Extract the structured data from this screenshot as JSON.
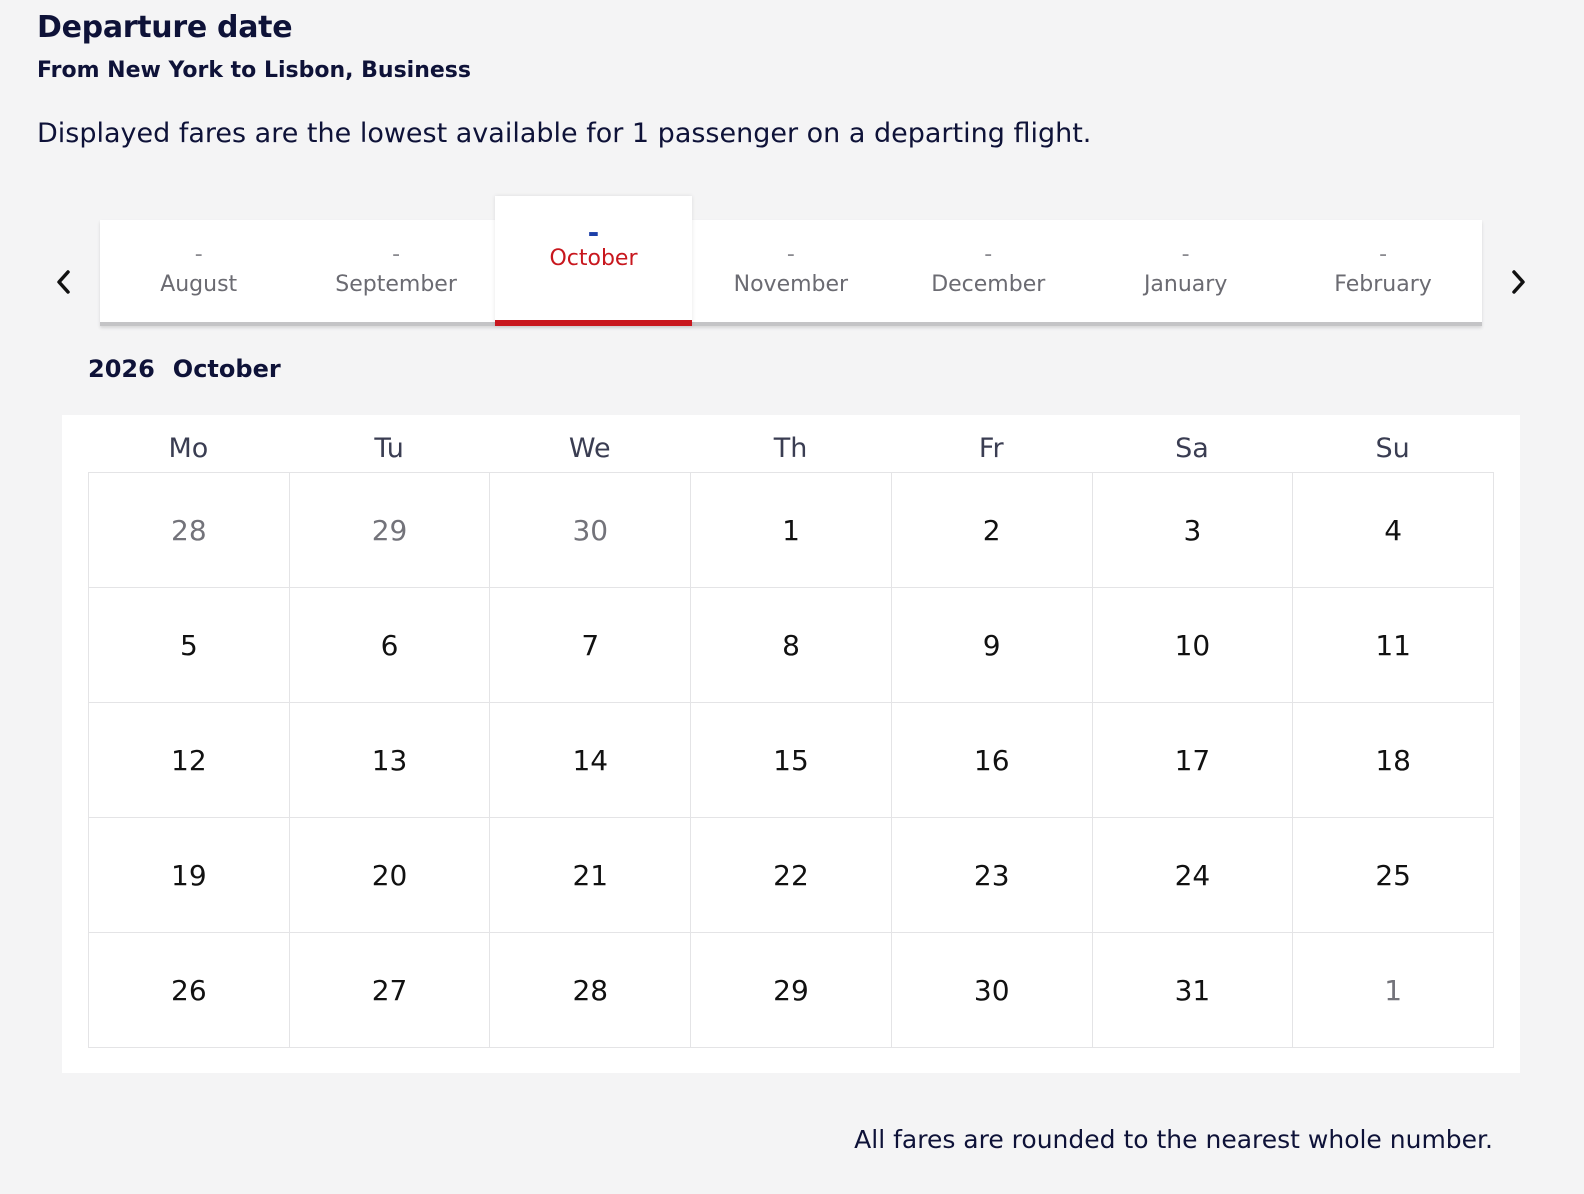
{
  "header": {
    "title": "Departure date",
    "subtitle": "From New York to Lisbon, Business",
    "info": "Displayed fares are the lowest available for 1 passenger on a departing flight."
  },
  "month_tabs": [
    {
      "fare": "-",
      "label": "August",
      "active": false
    },
    {
      "fare": "-",
      "label": "September",
      "active": false
    },
    {
      "fare": "-",
      "label": "October",
      "active": true
    },
    {
      "fare": "-",
      "label": "November",
      "active": false
    },
    {
      "fare": "-",
      "label": "December",
      "active": false
    },
    {
      "fare": "-",
      "label": "January",
      "active": false
    },
    {
      "fare": "-",
      "label": "February",
      "active": false
    }
  ],
  "nav": {
    "prev_icon": "chevron-left-icon",
    "next_icon": "chevron-right-icon"
  },
  "calendar": {
    "year": "2026",
    "month": "October",
    "weekdays": [
      "Mo",
      "Tu",
      "We",
      "Th",
      "Fr",
      "Sa",
      "Su"
    ],
    "days": [
      {
        "label": "28",
        "muted": true
      },
      {
        "label": "29",
        "muted": true
      },
      {
        "label": "30",
        "muted": true
      },
      {
        "label": "1",
        "muted": false
      },
      {
        "label": "2",
        "muted": false
      },
      {
        "label": "3",
        "muted": false
      },
      {
        "label": "4",
        "muted": false
      },
      {
        "label": "5",
        "muted": false
      },
      {
        "label": "6",
        "muted": false
      },
      {
        "label": "7",
        "muted": false
      },
      {
        "label": "8",
        "muted": false
      },
      {
        "label": "9",
        "muted": false
      },
      {
        "label": "10",
        "muted": false
      },
      {
        "label": "11",
        "muted": false
      },
      {
        "label": "12",
        "muted": false
      },
      {
        "label": "13",
        "muted": false
      },
      {
        "label": "14",
        "muted": false
      },
      {
        "label": "15",
        "muted": false
      },
      {
        "label": "16",
        "muted": false
      },
      {
        "label": "17",
        "muted": false
      },
      {
        "label": "18",
        "muted": false
      },
      {
        "label": "19",
        "muted": false
      },
      {
        "label": "20",
        "muted": false
      },
      {
        "label": "21",
        "muted": false
      },
      {
        "label": "22",
        "muted": false
      },
      {
        "label": "23",
        "muted": false
      },
      {
        "label": "24",
        "muted": false
      },
      {
        "label": "25",
        "muted": false
      },
      {
        "label": "26",
        "muted": false
      },
      {
        "label": "27",
        "muted": false
      },
      {
        "label": "28",
        "muted": false
      },
      {
        "label": "29",
        "muted": false
      },
      {
        "label": "30",
        "muted": false
      },
      {
        "label": "31",
        "muted": false
      },
      {
        "label": "1",
        "muted": true
      }
    ]
  },
  "footnote": "All fares are rounded to the nearest whole number.",
  "colors": {
    "text_primary": "#0e1238",
    "active_accent": "#c8171e",
    "active_fare": "#1d3fa8",
    "background": "#f4f4f5"
  }
}
